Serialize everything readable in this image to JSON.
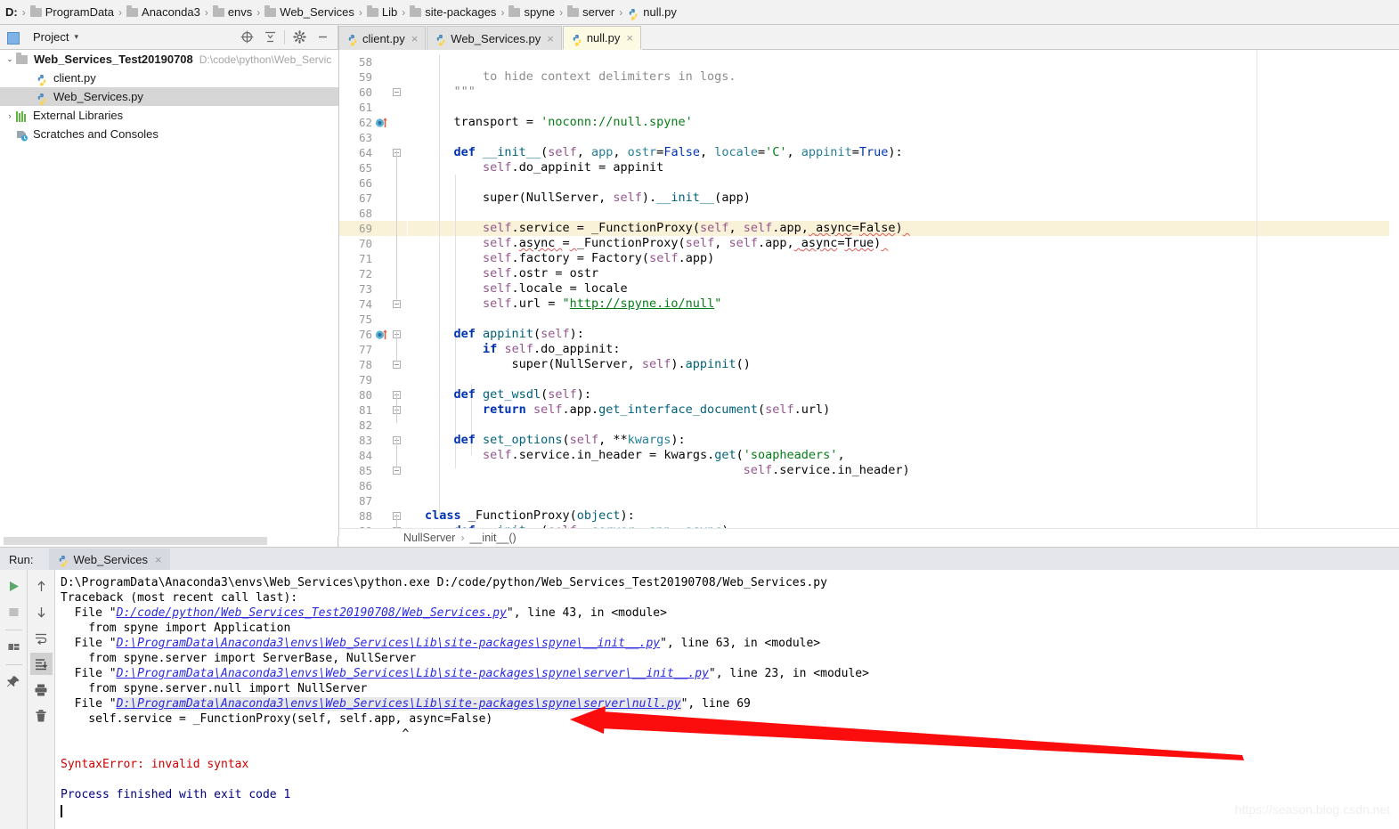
{
  "breadcrumb": {
    "items": [
      {
        "label": "D:",
        "icon": "drive-icon",
        "bold": true
      },
      {
        "label": "ProgramData",
        "icon": "folder-icon"
      },
      {
        "label": "Anaconda3",
        "icon": "folder-icon"
      },
      {
        "label": "envs",
        "icon": "folder-icon"
      },
      {
        "label": "Web_Services",
        "icon": "folder-icon"
      },
      {
        "label": "Lib",
        "icon": "folder-icon"
      },
      {
        "label": "site-packages",
        "icon": "folder-icon"
      },
      {
        "label": "spyne",
        "icon": "folder-icon"
      },
      {
        "label": "server",
        "icon": "folder-icon"
      },
      {
        "label": "null.py",
        "icon": "python-file-icon"
      }
    ]
  },
  "project_panel": {
    "title": "Project",
    "caret": "▾",
    "icons": [
      "locate-target-icon",
      "collapse-all-icon",
      "gear-icon",
      "minimize-icon"
    ],
    "tree": [
      {
        "label": "Web_Services_Test20190708",
        "path": "D:\\code\\python\\Web_Servic",
        "twisty": "⌄",
        "icon": "folder-icon",
        "bold": true,
        "depth": 0,
        "selected": false
      },
      {
        "label": "client.py",
        "path": "",
        "twisty": "",
        "icon": "python-file-icon",
        "bold": false,
        "depth": 1,
        "selected": false
      },
      {
        "label": "Web_Services.py",
        "path": "",
        "twisty": "",
        "icon": "python-file-icon",
        "bold": false,
        "depth": 1,
        "selected": true
      },
      {
        "label": "External Libraries",
        "path": "",
        "twisty": "›",
        "icon": "library-icon",
        "bold": false,
        "depth": 0,
        "selected": false
      },
      {
        "label": "Scratches and Consoles",
        "path": "",
        "twisty": "",
        "icon": "scratches-icon",
        "bold": false,
        "depth": 0,
        "selected": false
      }
    ]
  },
  "editor_tabs": [
    {
      "label": "client.py",
      "icon": "python-file-icon",
      "active": false,
      "close": "×"
    },
    {
      "label": "Web_Services.py",
      "icon": "python-file-icon",
      "active": false,
      "close": "×"
    },
    {
      "label": "null.py",
      "icon": "python-file-icon",
      "active": true,
      "close": "×"
    }
  ],
  "editor": {
    "first_line": 58,
    "highlighted_line": 69,
    "gutter_markers": [
      {
        "line": 62,
        "icon": "override-method-icon"
      },
      {
        "line": 76,
        "icon": "override-method-icon"
      }
    ],
    "lines": [
      {
        "n": 58,
        "text": ""
      },
      {
        "n": 59,
        "text": "        to hide context delimiters in logs."
      },
      {
        "n": 60,
        "text": "    \"\"\""
      },
      {
        "n": 61,
        "text": ""
      },
      {
        "n": 62,
        "text": "    transport = 'noconn://null.spyne'"
      },
      {
        "n": 63,
        "text": ""
      },
      {
        "n": 64,
        "text": "    def __init__(self, app, ostr=False, locale='C', appinit=True):"
      },
      {
        "n": 65,
        "text": "        self.do_appinit = appinit"
      },
      {
        "n": 66,
        "text": ""
      },
      {
        "n": 67,
        "text": "        super(NullServer, self).__init__(app)"
      },
      {
        "n": 68,
        "text": ""
      },
      {
        "n": 69,
        "text": "        self.service = _FunctionProxy(self, self.app, async=False)"
      },
      {
        "n": 70,
        "text": "        self.async = _FunctionProxy(self, self.app, async=True)"
      },
      {
        "n": 71,
        "text": "        self.factory = Factory(self.app)"
      },
      {
        "n": 72,
        "text": "        self.ostr = ostr"
      },
      {
        "n": 73,
        "text": "        self.locale = locale"
      },
      {
        "n": 74,
        "text": "        self.url = \"http://spyne.io/null\""
      },
      {
        "n": 75,
        "text": ""
      },
      {
        "n": 76,
        "text": "    def appinit(self):"
      },
      {
        "n": 77,
        "text": "        if self.do_appinit:"
      },
      {
        "n": 78,
        "text": "            super(NullServer, self).appinit()"
      },
      {
        "n": 79,
        "text": ""
      },
      {
        "n": 80,
        "text": "    def get_wsdl(self):"
      },
      {
        "n": 81,
        "text": "        return self.app.get_interface_document(self.url)"
      },
      {
        "n": 82,
        "text": ""
      },
      {
        "n": 83,
        "text": "    def set_options(self, **kwargs):"
      },
      {
        "n": 84,
        "text": "        self.service.in_header = kwargs.get('soapheaders',"
      },
      {
        "n": 85,
        "text": "                                            self.service.in_header)"
      },
      {
        "n": 86,
        "text": ""
      },
      {
        "n": 87,
        "text": ""
      },
      {
        "n": 88,
        "text": "class _FunctionProxy(object):"
      },
      {
        "n": 89,
        "text": "    def __init__(self, server, app, async):"
      }
    ]
  },
  "nav_breadcrumb": {
    "items": [
      "NullServer",
      "__init__()"
    ],
    "separator": "›"
  },
  "run_panel": {
    "label": "Run:",
    "tab": {
      "label": "Web_Services",
      "icon": "python-file-icon",
      "close": "×"
    },
    "left_tools": [
      "run-icon",
      "stop-icon",
      "layout-icon",
      "pin-icon"
    ],
    "right_tools": [
      "scroll-up-icon",
      "scroll-down-icon",
      "soft-wrap-icon",
      "scroll-to-end-icon",
      "print-icon",
      "trash-icon"
    ],
    "selected_tool": "scroll-to-end-icon",
    "console": [
      {
        "type": "plain",
        "text": "D:\\ProgramData\\Anaconda3\\envs\\Web_Services\\python.exe D:/code/python/Web_Services_Test20190708/Web_Services.py"
      },
      {
        "type": "plain",
        "text": "Traceback (most recent call last):"
      },
      {
        "type": "file",
        "prefix": "  File \"",
        "link": "D:/code/python/Web_Services_Test20190708/Web_Services.py",
        "suffix": "\", line 43, in <module>",
        "marked": false
      },
      {
        "type": "plain",
        "text": "    from spyne import Application"
      },
      {
        "type": "file",
        "prefix": "  File \"",
        "link": "D:\\ProgramData\\Anaconda3\\envs\\Web_Services\\Lib\\site-packages\\spyne\\__init__.py",
        "suffix": "\", line 63, in <module>",
        "marked": false
      },
      {
        "type": "plain",
        "text": "    from spyne.server import ServerBase, NullServer"
      },
      {
        "type": "file",
        "prefix": "  File \"",
        "link": "D:\\ProgramData\\Anaconda3\\envs\\Web_Services\\Lib\\site-packages\\spyne\\server\\__init__.py",
        "suffix": "\", line 23, in <module>",
        "marked": false
      },
      {
        "type": "plain",
        "text": "    from spyne.server.null import NullServer"
      },
      {
        "type": "file",
        "prefix": "  File \"",
        "link": "D:\\ProgramData\\Anaconda3\\envs\\Web_Services\\Lib\\site-packages\\spyne\\server\\null.py",
        "suffix": "\", line 69",
        "marked": true
      },
      {
        "type": "plain",
        "text": "    self.service = _FunctionProxy(self, self.app, async=False)"
      },
      {
        "type": "plain",
        "text": "                                                 ^"
      },
      {
        "type": "blank",
        "text": ""
      },
      {
        "type": "error",
        "text": "SyntaxError: invalid syntax"
      },
      {
        "type": "blank",
        "text": ""
      },
      {
        "type": "exit",
        "text": "Process finished with exit code 1"
      }
    ]
  },
  "annotation": {
    "shape": "red-arrow",
    "color": "#fb0d0d"
  },
  "watermark": "https://season.blog.csdn.net"
}
